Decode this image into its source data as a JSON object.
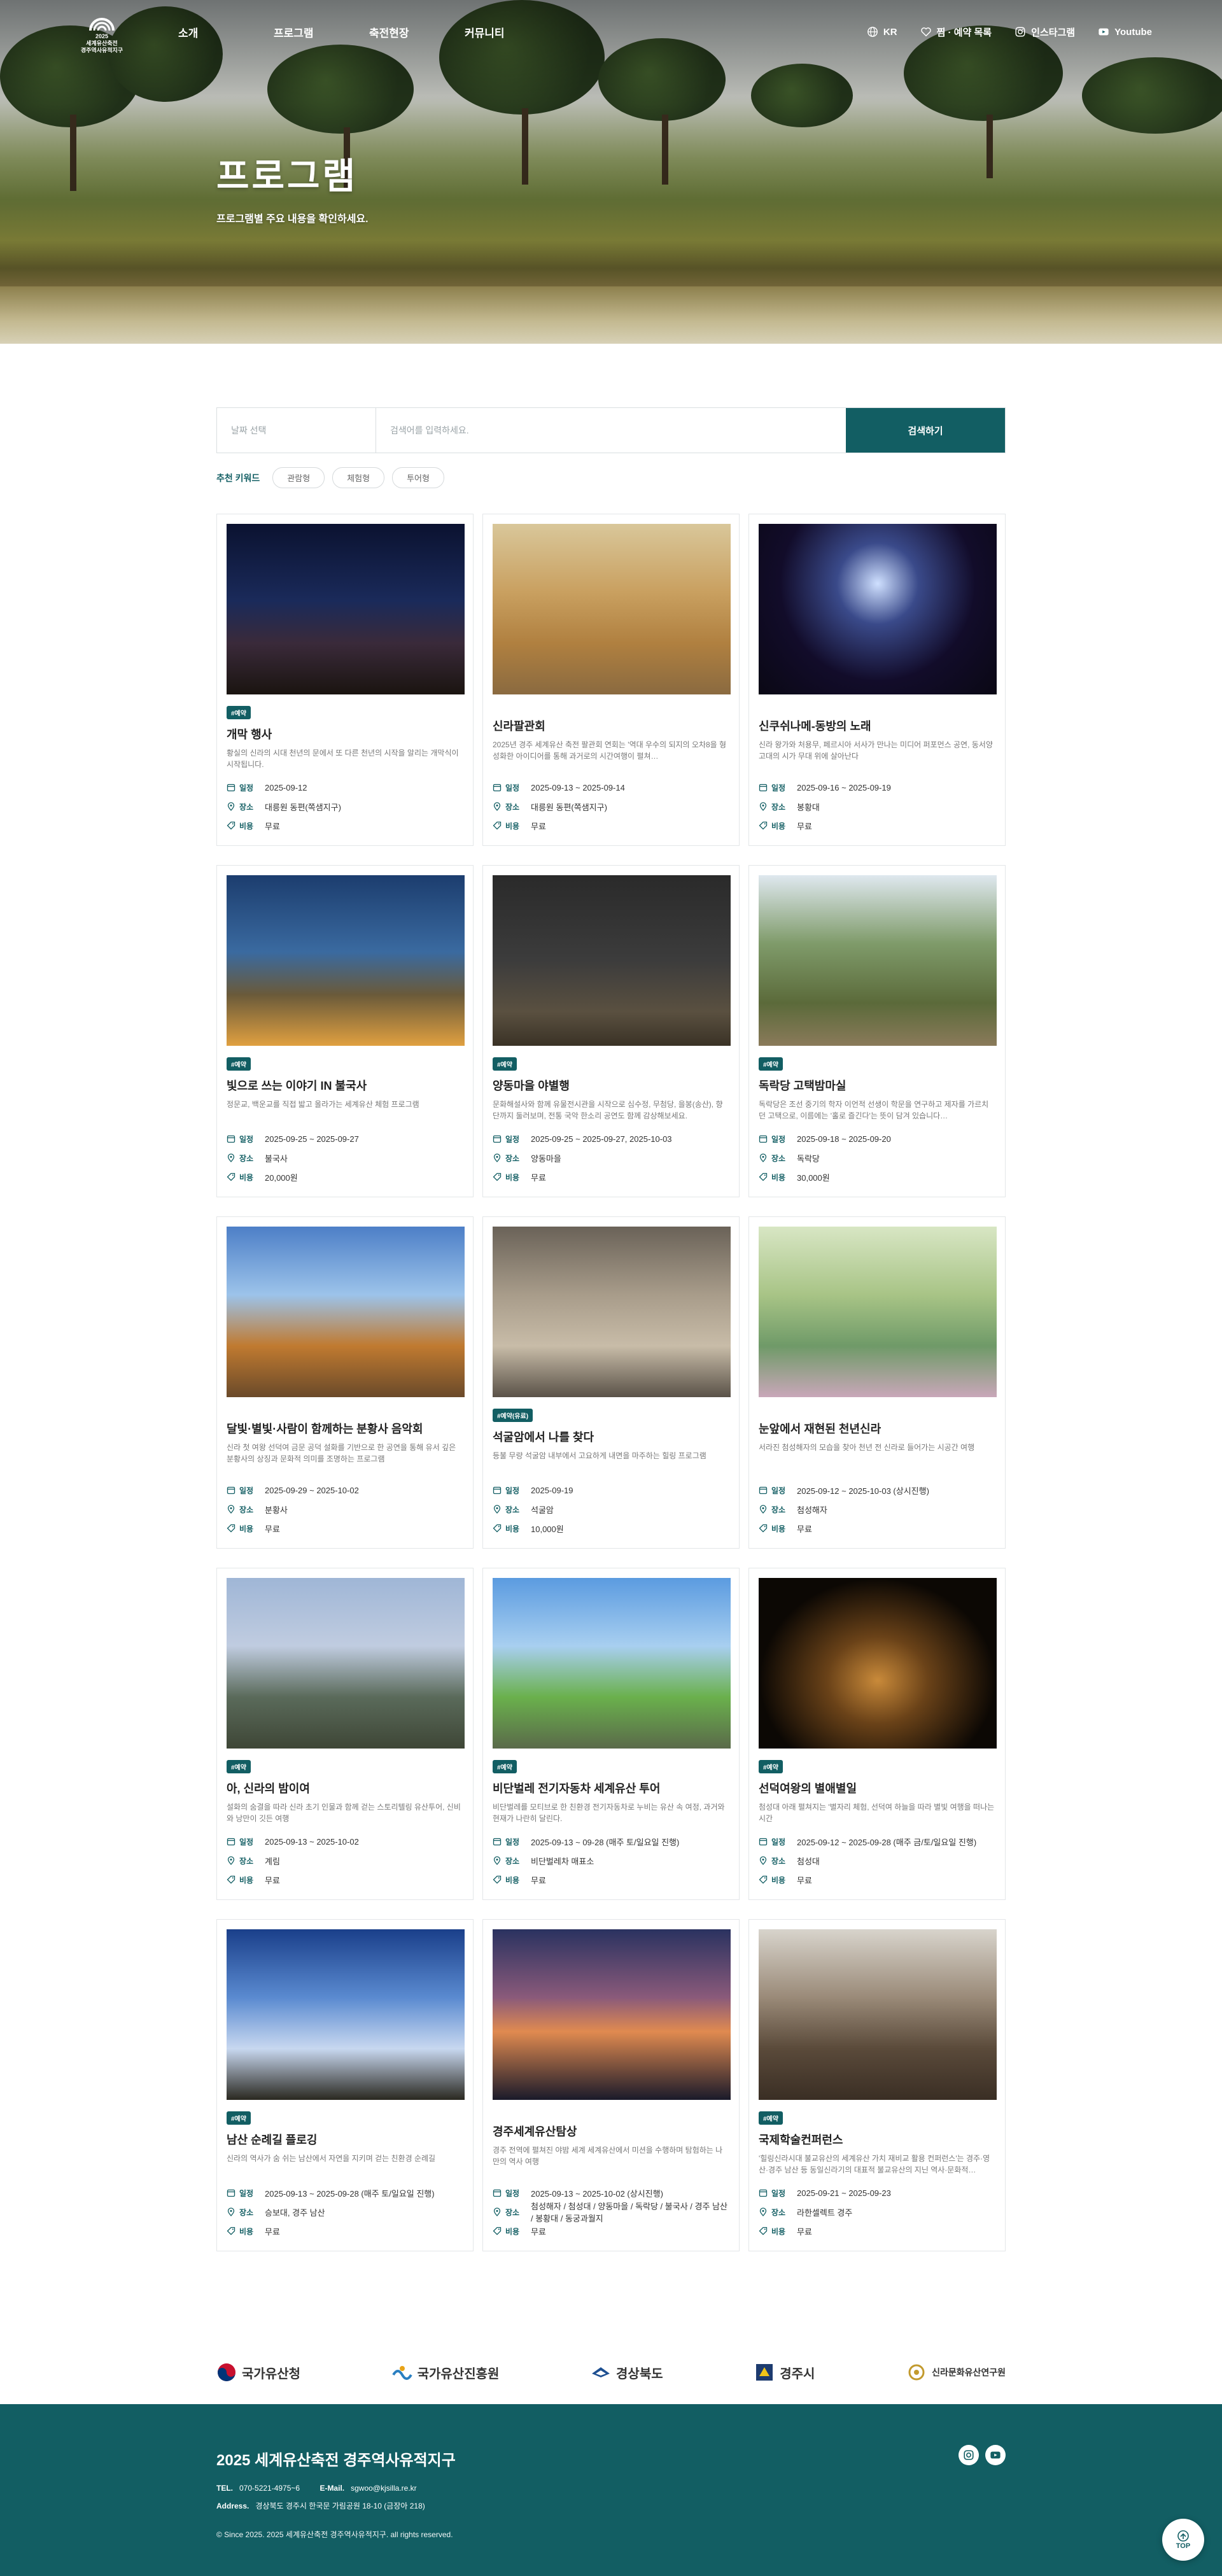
{
  "header": {
    "logo_lines": [
      "2025",
      "세계유산축전",
      "경주역사유적지구"
    ],
    "nav": [
      "소개",
      "프로그램",
      "축전현장",
      "커뮤니티"
    ],
    "util": {
      "lang": "KR",
      "wishlist": "찜 · 예약 목록",
      "instagram": "인스타그램",
      "youtube": "Youtube"
    }
  },
  "hero": {
    "title": "프로그램",
    "subtitle": "프로그램별 주요 내용을 확인하세요."
  },
  "search": {
    "select_placeholder": "날짜 선택",
    "input_placeholder": "검색어를 입력하세요.",
    "button": "검색하기",
    "keyword_label": "추천 키워드",
    "keywords": [
      "관람형",
      "체험형",
      "투어형"
    ]
  },
  "meta_labels": {
    "date": "일정",
    "place": "장소",
    "fee": "비용"
  },
  "colors": {
    "brand": "#125e63"
  },
  "programs": [
    {
      "badge": "#예약",
      "title": "개막 행사",
      "desc": "황실의 신라의 시대 천년의 문에서 또 다른 천년의 시작을 알리는 개막식이 시작됩니다.",
      "date": "2025-09-12",
      "place": "대릉원 동편(쪽샘지구)",
      "fee": "무료"
    },
    {
      "badge": "",
      "title": "신라팔관회",
      "desc": "2025년 경주 세계유산 축전 팔관회 연회는 '역대 우수의 되지의 오차8을 형성화한 아이디어를 통해 과거로의 시간여행이 펼쳐…",
      "date": "2025-09-13 ~ 2025-09-14",
      "place": "대릉원 동편(쪽샘지구)",
      "fee": "무료"
    },
    {
      "badge": "",
      "title": "신쿠쉬나메-동방의 노래",
      "desc": "신라 왕가와 처용무, 페르시아 서사가 만나는 미디어 퍼포먼스 공연, 동서양 고대의 시가 무대 위에 살아난다",
      "date": "2025-09-16 ~ 2025-09-19",
      "place": "봉황대",
      "fee": "무료"
    },
    {
      "badge": "#예약",
      "title": "빛으로 쓰는 이야기 IN 불국사",
      "desc": "정문교, 백운교를 직접 밟고 올라가는 세계유산 체험 프로그램",
      "date": "2025-09-25 ~ 2025-09-27",
      "place": "불국사",
      "fee": "20,000원"
    },
    {
      "badge": "#예약",
      "title": "양동마을 야별행",
      "desc": "문화해설사와 함께 유물전시관을 시작으로 심수정, 무첨당, 을봉(송산), 향단까지 둘러보며, 전통 국악 한소리 공연도 함께 감상해보세요.",
      "date": "2025-09-25 ~ 2025-09-27, 2025-10-03",
      "place": "양동마을",
      "fee": "무료"
    },
    {
      "badge": "#예약",
      "title": "독락당 고택밤마실",
      "desc": "독락당은 조선 중기의 학자 이언적 선생이 학문을 연구하고 제자를 가르치던 고택으로, 이름에는 '홀로 즐긴다'는 뜻이 담겨 있습니다…",
      "date": "2025-09-18 ~ 2025-09-20",
      "place": "독락당",
      "fee": "30,000원"
    },
    {
      "badge": "",
      "title": "달빛·별빛·사람이 함께하는 분황사 음악회",
      "desc": "신라 첫 여왕 선덕여 금문 공덕 설화를 기반으로 한 공연을 통해 유서 깊은 분황사의 상징과 문화적 의미를 조명하는 프로그램",
      "date": "2025-09-29 ~ 2025-10-02",
      "place": "분황사",
      "fee": "무료"
    },
    {
      "badge": "#예약(유료)",
      "title": "석굴암에서 나를 찾다",
      "desc": "등불 무량 석굴암 내부에서 고요하게 내면을 마주하는 힐링 프로그램",
      "date": "2025-09-19",
      "place": "석굴암",
      "fee": "10,000원"
    },
    {
      "badge": "",
      "title": "눈앞에서 재현된 천년신라",
      "desc": "서라진 첨성해자의 모습을 찾아 천년 전 신라로 들어가는 시공간 여행",
      "date": "2025-09-12 ~ 2025-10-03 (상시진행)",
      "place": "첨성해자",
      "fee": "무료"
    },
    {
      "badge": "#예약",
      "title": "아, 신라의 밤이여",
      "desc": "설화의 숨결을 따라 신라 초기 인물과 함께 걷는 스토리텔링 유산투어, 신비와 낭만이 깃든 여행",
      "date": "2025-09-13 ~ 2025-10-02",
      "place": "계림",
      "fee": "무료"
    },
    {
      "badge": "#예약",
      "title": "비단벌레 전기자동차 세계유산 투어",
      "desc": "비단벌레를 모티브로 한 친환경 전기자동차로 누비는 유산 속 여정, 과거와 현재가 나란히 달린다.",
      "date": "2025-09-13 ~ 09-28 (매주 토/일요일 진행)",
      "place": "비단벌레차 매표소",
      "fee": "무료"
    },
    {
      "badge": "#예약",
      "title": "선덕여왕의 별애별일",
      "desc": "첨성대 아래 펼쳐지는 '별자리 체험, 선덕여 하늘을 따라 별빛 여행을 떠나는 시간",
      "date": "2025-09-12 ~ 2025-09-28 (매주 금/토/일요일 진행)",
      "place": "첨성대",
      "fee": "무료"
    },
    {
      "badge": "#예약",
      "title": "남산 순례길 플로깅",
      "desc": "신라의 역사가 숨 쉬는 남산에서 자연을 지키며 걷는 친환경 순례길",
      "date": "2025-09-13 ~ 2025-09-28 (매주 토/일요일 진행)",
      "place": "승보대, 경주 남산",
      "fee": "무료"
    },
    {
      "badge": "",
      "title": "경주세계유산탐상",
      "desc": "경주 전역에 펼쳐진 야밤 세계 세계유산에서 미션을 수행하며 탐험하는 나만의 역사 여행",
      "date": "2025-09-13 ~ 2025-10-02 (상시진행)",
      "place": "첨성해자 / 첨성대 / 양동마을 / 독락당 / 불국사 / 경주 남산 / 봉황대 / 동궁과월지",
      "fee": "무료"
    },
    {
      "badge": "#예약",
      "title": "국제학술컨퍼런스",
      "desc": "'힐링신라시대 불교유산의 세계유산 가치 재비교 활용 컨퍼런스'는 경주·영산·경주 남산 등 동일신라기의 대표적 불교유산의 지닌 역사·문화적…",
      "date": "2025-09-21 ~ 2025-09-23",
      "place": "라한셀렉트 경주",
      "fee": "무료"
    }
  ],
  "partners": [
    "국가유산청",
    "국가유산진흥원",
    "경상북도",
    "경주시",
    "신라문화유산연구원"
  ],
  "footer": {
    "title": "2025 세계유산축전 경주역사유적지구",
    "tel_label": "TEL.",
    "tel": "070-5221-4975~6",
    "email_label": "E-Mail.",
    "email": "sgwoo@kjsilla.re.kr",
    "address_label": "Address.",
    "address": "경상북도 경주시 한국문 가림공원 18-10 (금장아 218)",
    "copyright": "© Since 2025. 2025 세계유산축전 경주역사유적지구. all rights reserved.",
    "top": "TOP"
  }
}
